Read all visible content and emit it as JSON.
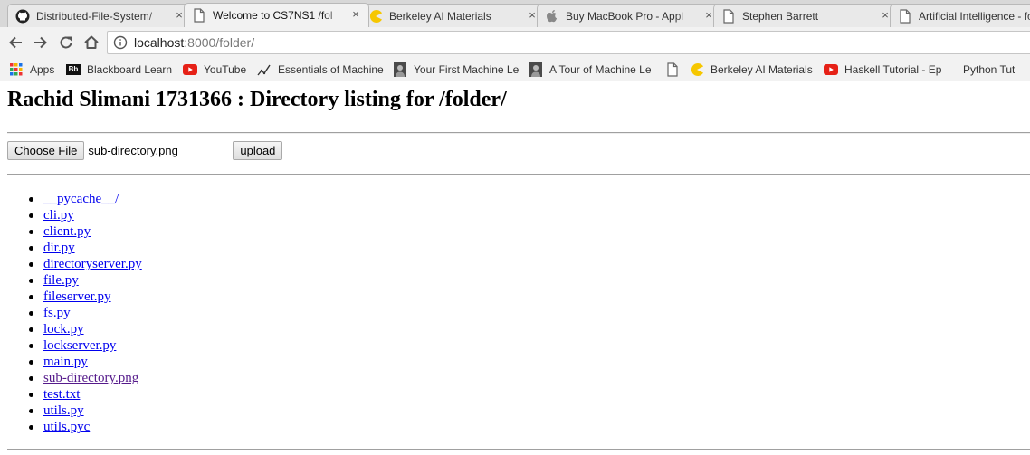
{
  "browser": {
    "tabs": [
      {
        "title": "Distributed-File-System/",
        "icon": "github-icon",
        "active": false
      },
      {
        "title": "Welcome to CS7NS1 /fol",
        "icon": "page-icon",
        "active": true
      },
      {
        "title": "Berkeley AI Materials",
        "icon": "pacman-icon",
        "active": false
      },
      {
        "title": "Buy MacBook Pro - Appl",
        "icon": "apple-icon",
        "active": false
      },
      {
        "title": "Stephen Barrett",
        "icon": "page-icon",
        "active": false
      },
      {
        "title": "Artificial Intelligence - fo",
        "icon": "page-icon",
        "active": false
      }
    ],
    "close_glyph": "×",
    "url_host": "localhost",
    "url_path": ":8000/folder/",
    "bookmarks": [
      {
        "label": "Apps",
        "icon": "apps-grid-icon"
      },
      {
        "label": "Blackboard Learn",
        "icon": "blackboard-icon",
        "icon_text": "Bb"
      },
      {
        "label": "YouTube",
        "icon": "youtube-icon"
      },
      {
        "label": "Essentials of Machine",
        "icon": "chart-icon"
      },
      {
        "label": "Your First Machine Le",
        "icon": "portrait-icon"
      },
      {
        "label": "A Tour of Machine Le",
        "icon": "portrait-icon"
      },
      {
        "label": "",
        "icon": "page-icon"
      },
      {
        "label": "Berkeley AI Materials",
        "icon": "pacman-icon"
      },
      {
        "label": "Haskell Tutorial - Ep",
        "icon": "youtube-icon"
      },
      {
        "label": "Python Tut",
        "icon": "none"
      }
    ]
  },
  "page": {
    "heading": "Rachid Slimani 1731366 : Directory listing for /folder/",
    "choose_file_label": "Choose File",
    "selected_file": "sub-directory.png",
    "upload_label": "upload",
    "files": [
      {
        "name": "__pycache__/",
        "visited": false
      },
      {
        "name": "cli.py",
        "visited": false
      },
      {
        "name": "client.py",
        "visited": false
      },
      {
        "name": "dir.py",
        "visited": false
      },
      {
        "name": "directoryserver.py",
        "visited": false
      },
      {
        "name": "file.py",
        "visited": false
      },
      {
        "name": "fileserver.py",
        "visited": false
      },
      {
        "name": "fs.py",
        "visited": false
      },
      {
        "name": "lock.py",
        "visited": false
      },
      {
        "name": "lockserver.py",
        "visited": false
      },
      {
        "name": "main.py",
        "visited": false
      },
      {
        "name": "sub-directory.png",
        "visited": true
      },
      {
        "name": "test.txt",
        "visited": false
      },
      {
        "name": "utils.py",
        "visited": false
      },
      {
        "name": "utils.pyc",
        "visited": false
      }
    ]
  },
  "colors": {
    "link": "#0000ee",
    "visited_link": "#551a8b",
    "youtube_red": "#e62117",
    "pacman_yellow": "#f6c700"
  }
}
